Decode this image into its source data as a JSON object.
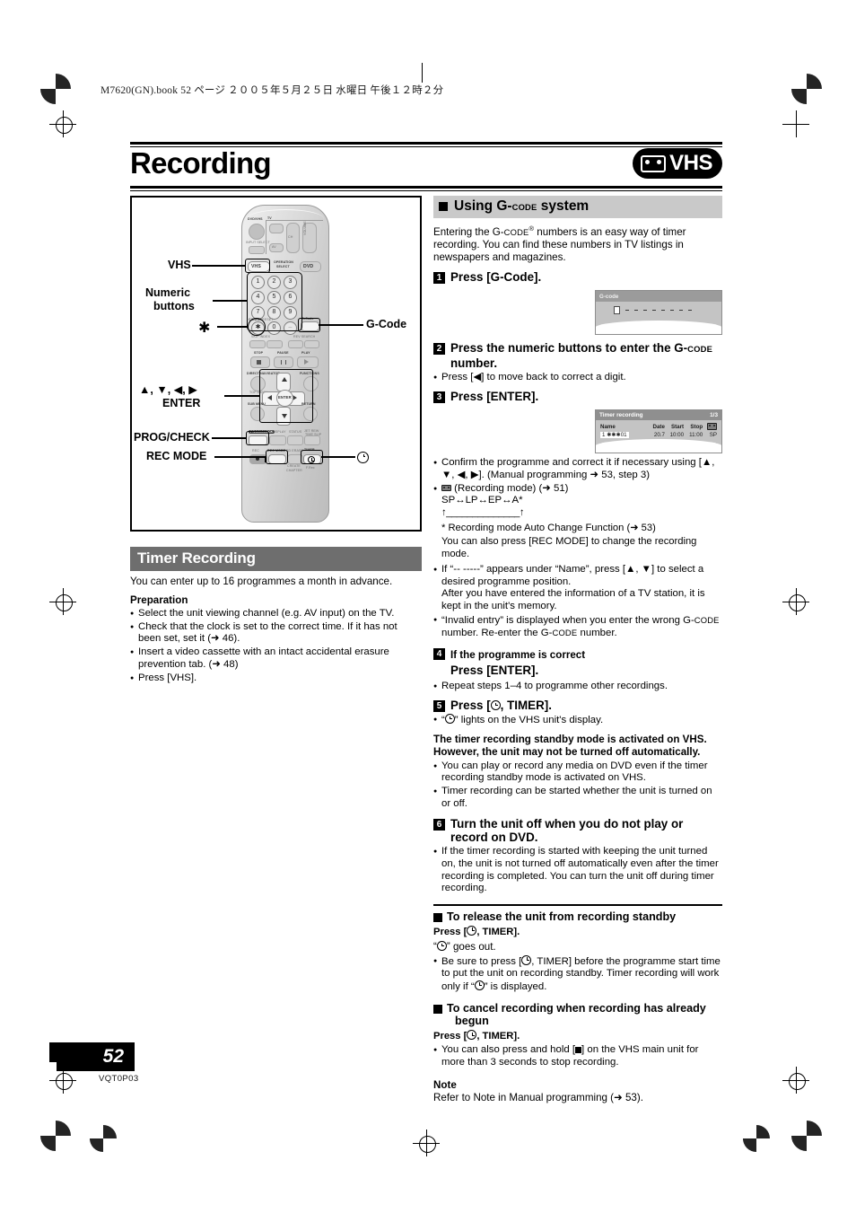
{
  "file_header": "M7620(GN).book   52 ページ   ２００５年５月２５日   水曜日   午後１２時２分",
  "title": {
    "heading": "Recording",
    "badge_label": "VHS",
    "badge_icon": "vhs-cassette-icon"
  },
  "figure": {
    "labels": {
      "vhs": "VHS",
      "numeric_line1": "Numeric",
      "numeric_line2": "buttons",
      "asterisk": "✱",
      "gcode": "G-Code",
      "arrows": "▲, ▼, ◀, ▶",
      "enter": "ENTER",
      "prog_check": "PROG/CHECK",
      "rec_mode": "REC MODE",
      "timer_icon": "timer-clock-icon"
    },
    "remote": {
      "power_label": "DVD/VHS",
      "input_select": "INPUT SELECT",
      "tv_label": "TV",
      "ch_label": "CH",
      "volume_label": "VOLUME",
      "av_label": "AV",
      "operation_select_l1": "OPERATION",
      "operation_select_l2": "SELECT",
      "vhs_btn": "VHS",
      "dvd_btn": "DVD",
      "keys": [
        "1",
        "2",
        "3",
        "4",
        "5",
        "6",
        "7",
        "8",
        "9",
        "0"
      ],
      "cancel": "CANCEL",
      "reset": "RESET",
      "gcode_btn": "G-Code",
      "skip_index": "SKIP INDEX",
      "rev_search": "REV SEARCH",
      "stop": "STOP",
      "pause": "PAUSE",
      "play": "PLAY",
      "direct_navigator": "DIRECT NAVIGATOR",
      "top_menu": "TOP MENU",
      "function": "FUNCTIONS",
      "sub_menu": "SUB MENU",
      "return": "RETURN",
      "enter": "ENTER",
      "prog_check": "PROG/CHECK",
      "display": "DISPLAY",
      "status": "STATUS",
      "time_slip": "TIME SLIP",
      "jet_rew": "JET REW",
      "rec": "REC",
      "rec_mode": "REC MODE",
      "sd_erase": "SD ERASE",
      "timer": "TIMER",
      "create_chapter_l1": "CREATE",
      "create_chapter_l2": "CHAPTER",
      "f_rec": "F.Rec"
    }
  },
  "timer_recording": {
    "heading": "Timer Recording",
    "intro": "You can enter up to 16 programmes a month in advance.",
    "preparation_heading": "Preparation",
    "preparation": [
      "Select the unit viewing channel (e.g. AV input) on the TV.",
      "Check that the clock is set to the correct time. If it has not been set, set it (➜ 46).",
      "Insert a video cassette with an intact accidental erasure prevention tab. (➜ 48)",
      "Press [VHS]."
    ]
  },
  "gcode": {
    "heading_pre": "Using G-",
    "heading_smallcaps": "CODE",
    "heading_post": " system",
    "intro_l1_pre": "Entering the G-",
    "intro_l1_sc": "CODE",
    "intro_l1_post": " numbers is an easy way of timer recording.",
    "intro_l2": "You can find these numbers in TV listings in newspapers and",
    "intro_l3": "magazines.",
    "step1_num": "1",
    "step1_text": "Press [G-Code].",
    "osd1": {
      "title": "G-code",
      "dash_count": 8
    },
    "step2_num": "2",
    "step2_text_pre": "Press the numeric buttons to enter the G-",
    "step2_text_sc": "CODE",
    "step2_text_post": "number.",
    "step2_bullet": "Press [◀] to move back to correct a digit.",
    "step3_num": "3",
    "step3_text": "Press [ENTER].",
    "osd2": {
      "title": "Timer recording",
      "page": "1/3",
      "columns": [
        "Name",
        "Date",
        "Start",
        "Stop",
        "rec-mode-icon"
      ],
      "rows": [
        {
          "index": "1",
          "name": "✱✱✱01",
          "date": "20.7",
          "start": "10:00",
          "stop": "11:00",
          "mode": "SP"
        },
        {
          "index": "",
          "name": "- -",
          "date": "- - . - -",
          "start": "- - : - -",
          "stop": "- - : - -",
          "mode": "-"
        },
        {
          "index": "",
          "name": "",
          "date": "",
          "start": "- - : - -",
          "stop": "- - : - -",
          "mode": "-"
        }
      ]
    },
    "bullets_after_3": [
      "Confirm the programme and correct it if necessary using [▲, ▼, ◀, ▶]. (Manual programming ➜ 53, step 3)"
    ],
    "recmode_line": "(Recording mode) (➜ 51)",
    "recmode_cycle": "SP↔LP↔EP↔A*",
    "recmode_note1": "* Recording mode Auto Change Function (➜ 53)",
    "recmode_note2": "You can also press [REC MODE] to change the recording mode.",
    "bullet_name_l1": "If “-- -----” appears under “Name”, press [▲, ▼] to select a desired programme position.",
    "bullet_name_l2": "After you have entered the information of a TV station, it is kept in the unit's memory.",
    "bullet_invalid_pre": "“Invalid entry” is displayed when you enter the wrong G-",
    "bullet_invalid_sc": "CODE",
    "bullet_invalid_post": " number. Re-enter the G-",
    "bullet_invalid_post2": " number.",
    "step4_num": "4",
    "step4_line1": "If the programme is correct",
    "step4_line2": "Press [ENTER].",
    "step4_bullet": "Repeat steps 1–4 to programme other recordings.",
    "step5_num": "5",
    "step5_text_pre": "Press [",
    "step5_text_post": ", TIMER].",
    "step5_bullet_pre": "“",
    "step5_bullet_post": "” lights on the VHS unit's display.",
    "standby_l1": "The timer recording standby mode is activated on VHS.",
    "standby_l2": "However, the unit may not be turned off automatically.",
    "standby_bullets": [
      "You can play or record any media on DVD even if the timer recording standby mode is activated on VHS.",
      "Timer recording can be started whether the unit is turned on or off."
    ],
    "step6_num": "6",
    "step6_text": "Turn the unit off when you do not play or record on DVD.",
    "step6_bullet": "If the timer recording is started with keeping the unit turned on, the unit is not turned off automatically even after the timer recording is completed. You can turn the unit off during timer recording.",
    "release_heading": "To release the unit from recording standby",
    "release_press_pre": "Press [",
    "release_press_post": ", TIMER].",
    "release_goes_out_pre": "“",
    "release_goes_out_post": "” goes out.",
    "release_bullet_pre": "Be sure to press [",
    "release_bullet_mid": ", TIMER] before the programme start time to put the unit on recording standby. Timer recording will work only if “",
    "release_bullet_post": "” is displayed.",
    "cancel_heading_l1": "To cancel recording when recording has already",
    "cancel_heading_l2": "begun",
    "cancel_press_pre": "Press [",
    "cancel_press_post": ", TIMER].",
    "cancel_bullet_pre": "You can also press and hold [",
    "cancel_bullet_post": "] on the VHS main unit for more than 3 seconds to stop recording.",
    "note_heading": "Note",
    "note_text": "Refer to Note in Manual programming (➜ 53)."
  },
  "footer": {
    "page_number": "52",
    "part_number": "VQT0P03"
  }
}
